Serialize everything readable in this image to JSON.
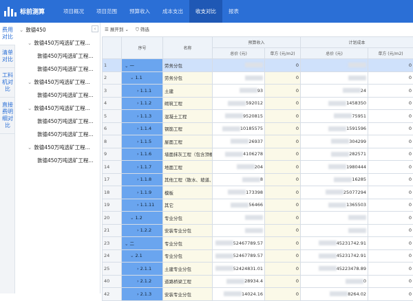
{
  "app": {
    "name": "标前测算"
  },
  "nav": [
    {
      "label": "项目概况"
    },
    {
      "label": "项目范围"
    },
    {
      "label": "预算收入"
    },
    {
      "label": "成本支出"
    },
    {
      "label": "收支对比"
    },
    {
      "label": "报表"
    }
  ],
  "vtabs": [
    {
      "label": "费用对比"
    },
    {
      "label": "清单对比"
    },
    {
      "label": "工料机对比"
    },
    {
      "label": "直接费明细对比"
    }
  ],
  "tree": {
    "root": "敦德450",
    "groups": [
      {
        "label": "敦德450万吨选矿工程...",
        "child": "敦德450万吨选矿工程..."
      },
      {
        "label": "敦德450万吨选矿工程...",
        "child": "敦德450万吨选矿工程..."
      },
      {
        "label": "敦德450万吨选矿工程...",
        "child": "敦德450万吨选矿工程..."
      },
      {
        "label": "敦德450万吨选矿工程...",
        "child": "敦德450万吨选矿工程..."
      }
    ],
    "extra": "敦德450万吨选矿工程..."
  },
  "toolbar": {
    "expand": "展开到",
    "filter": "筛选"
  },
  "table": {
    "headers": {
      "seq": "序号",
      "name": "名称",
      "budget": "预算收入",
      "plan": "计划成本",
      "total": "总价 (元)",
      "unit": "单方 (元/m2)"
    },
    "rows": [
      {
        "i": "1",
        "seq": "一",
        "name": "劳务分包",
        "bt": "",
        "bu": "0",
        "pt": "",
        "pu": "0",
        "lvl": 0,
        "sel": true
      },
      {
        "i": "2",
        "seq": "1.1",
        "name": "劳务分包",
        "bt": "",
        "bu": "0",
        "pt": "",
        "pu": "0",
        "lvl": 1
      },
      {
        "i": "3",
        "seq": "1.1.1",
        "name": "土建",
        "bt": "93",
        "bu": "0",
        "pt": "24",
        "pu": "0",
        "lvl": 2
      },
      {
        "i": "4",
        "seq": "1.1.2",
        "name": "砌筑工程",
        "bt": "592012",
        "bu": "0",
        "pt": "1458350",
        "pu": "0",
        "lvl": 2
      },
      {
        "i": "5",
        "seq": "1.1.3",
        "name": "混凝土工程",
        "bt": "9520815",
        "bu": "0",
        "pt": "75951",
        "pu": "0",
        "lvl": 2
      },
      {
        "i": "6",
        "seq": "1.1.4",
        "name": "钢筋工程",
        "bt": "10185575",
        "bu": "0",
        "pt": "1591596",
        "pu": "0",
        "lvl": 2
      },
      {
        "i": "8",
        "seq": "1.1.5",
        "name": "屋面工程",
        "bt": "26937",
        "bu": "0",
        "pt": "304299",
        "pu": "0",
        "lvl": 2
      },
      {
        "i": "9",
        "seq": "1.1.6",
        "name": "墙面抹灰工程（包含顶棚）",
        "bt": "4106278",
        "bu": "0",
        "pt": "282571",
        "pu": "0",
        "lvl": 2
      },
      {
        "i": "14",
        "seq": "1.1.7",
        "name": "地面工程",
        "bt": "204",
        "bu": "0",
        "pt": "1980444",
        "pu": "0",
        "lvl": 2
      },
      {
        "i": "17",
        "seq": "1.1.8",
        "name": "其他工程（散水、坡道、台阶）",
        "bt": "8",
        "bu": "0",
        "pt": "16285",
        "pu": "0",
        "lvl": 2
      },
      {
        "i": "18",
        "seq": "1.1.9",
        "name": "模板",
        "bt": "173398",
        "bu": "0",
        "pt": "25077294",
        "pu": "0",
        "lvl": 2
      },
      {
        "i": "19",
        "seq": "1.1.11",
        "name": "其它",
        "bt": "56466",
        "bu": "0",
        "pt": "1365503",
        "pu": "0",
        "lvl": 2
      },
      {
        "i": "20",
        "seq": "1.2",
        "name": "专业分包",
        "bt": "",
        "bu": "0",
        "pt": "",
        "pu": "0",
        "lvl": 1
      },
      {
        "i": "21",
        "seq": "1.2.2",
        "name": "安装专业分包",
        "bt": "",
        "bu": "0",
        "pt": "",
        "pu": "0",
        "lvl": 2
      },
      {
        "i": "23",
        "seq": "二",
        "name": "专业分包",
        "bt": "52467789.57",
        "bu": "0",
        "pt": "45231742.91",
        "pu": "0",
        "lvl": 0
      },
      {
        "i": "24",
        "seq": "2.1",
        "name": "专业分包",
        "bt": "52467789.57",
        "bu": "0",
        "pt": "45231742.91",
        "pu": "0",
        "lvl": 1
      },
      {
        "i": "25",
        "seq": "2.1.1",
        "name": "土建专业分包",
        "bt": "52424831.01",
        "bu": "0",
        "pt": "45223478.89",
        "pu": "0",
        "lvl": 2
      },
      {
        "i": "40",
        "seq": "2.1.2",
        "name": "道路桥梁工程",
        "bt": "28934.4",
        "bu": "0",
        "pt": "0",
        "pu": "0",
        "lvl": 2
      },
      {
        "i": "42",
        "seq": "2.1.3",
        "name": "安装专业分包",
        "bt": "14024.16",
        "bu": "0",
        "pt": "8264.02",
        "pu": "0",
        "lvl": 2
      }
    ]
  }
}
